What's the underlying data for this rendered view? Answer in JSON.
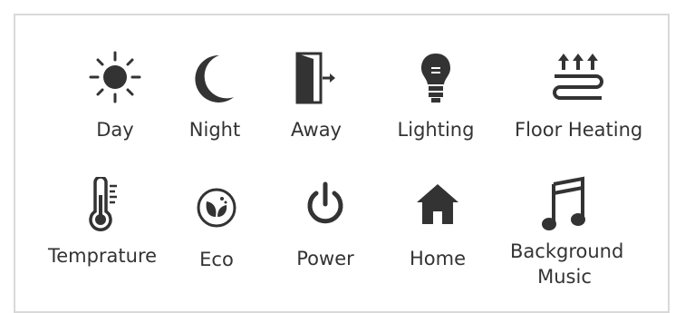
{
  "modes": [
    {
      "id": "day",
      "label": "Day",
      "icon": "sun-icon"
    },
    {
      "id": "night",
      "label": "Night",
      "icon": "moon-icon"
    },
    {
      "id": "away",
      "label": "Away",
      "icon": "door-exit-icon"
    },
    {
      "id": "lighting",
      "label": "Lighting",
      "icon": "light-bulb-icon"
    },
    {
      "id": "floor-heating",
      "label": "Floor Heating",
      "icon": "floor-heating-icon"
    },
    {
      "id": "temprature",
      "label": "Temprature",
      "icon": "thermometer-icon"
    },
    {
      "id": "eco",
      "label": "Eco",
      "icon": "eco-leaf-icon"
    },
    {
      "id": "power",
      "label": "Power",
      "icon": "power-icon"
    },
    {
      "id": "home",
      "label": "Home",
      "icon": "home-icon"
    },
    {
      "id": "background-music",
      "label": "Background Music",
      "icon": "music-note-icon"
    }
  ],
  "colors": {
    "icon": "#333333",
    "border": "#d9d9d9",
    "background": "#ffffff"
  }
}
